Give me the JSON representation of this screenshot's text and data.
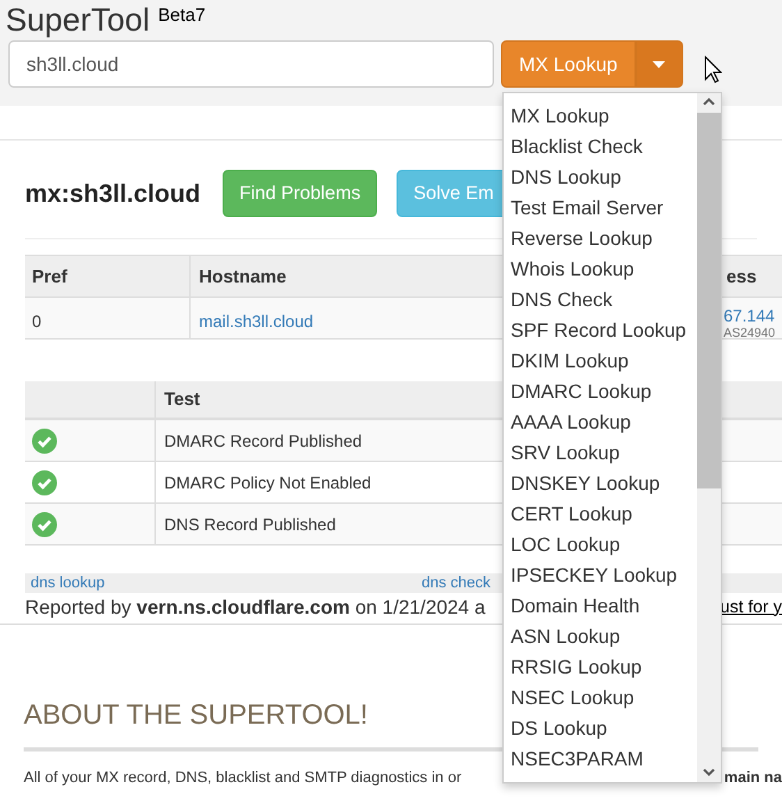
{
  "header": {
    "title": "SuperTool",
    "badge": "Beta7",
    "search": {
      "value": "sh3ll.cloud"
    },
    "action": {
      "label": "MX Lookup",
      "expanded": true
    }
  },
  "result": {
    "heading": "mx:sh3ll.cloud",
    "buttons": [
      {
        "label": "Find Problems",
        "kind": "success"
      },
      {
        "label": "Solve Em",
        "kind": "info"
      }
    ]
  },
  "mx_table": {
    "columns": [
      "Pref",
      "Hostname",
      "ess"
    ],
    "rows": [
      {
        "pref": "0",
        "hostname": "mail.sh3ll.cloud",
        "column_3": "67.144",
        "column_3_sub": "AS24940"
      }
    ]
  },
  "test_table": {
    "columns": [
      "Test"
    ],
    "rows": [
      {
        "passed": true,
        "test": "DMARC Record Published"
      },
      {
        "passed": true,
        "test": "DMARC Policy Not Enabled"
      },
      {
        "passed": true,
        "test": "DNS Record Published"
      }
    ]
  },
  "links": [
    "dns lookup",
    "dns check"
  ],
  "report": {
    "text": "Reported by **vern.ns.cloudflare.com** on 1/21/2024 a",
    "link": "ust for y"
  },
  "about": {
    "title": "ABOUT THE SUPERTOOL!",
    "text": "All of your MX record, DNS, blacklist and SMTP diagnostics in or",
    "text_end": "main na"
  },
  "menu": {
    "items": [
      "MX Lookup",
      "Blacklist Check",
      "DNS Lookup",
      "Test Email Server",
      "Reverse Lookup",
      "Whois Lookup",
      "DNS Check",
      "SPF Record Lookup",
      "DKIM Lookup",
      "DMARC Lookup",
      "AAAA Lookup",
      "SRV Lookup",
      "DNSKEY Lookup",
      "CERT Lookup",
      "LOC Lookup",
      "IPSECKEY Lookup",
      "Domain Health",
      "ASN Lookup",
      "RRSIG Lookup",
      "NSEC Lookup",
      "DS Lookup",
      "NSEC3PARAM"
    ]
  }
}
